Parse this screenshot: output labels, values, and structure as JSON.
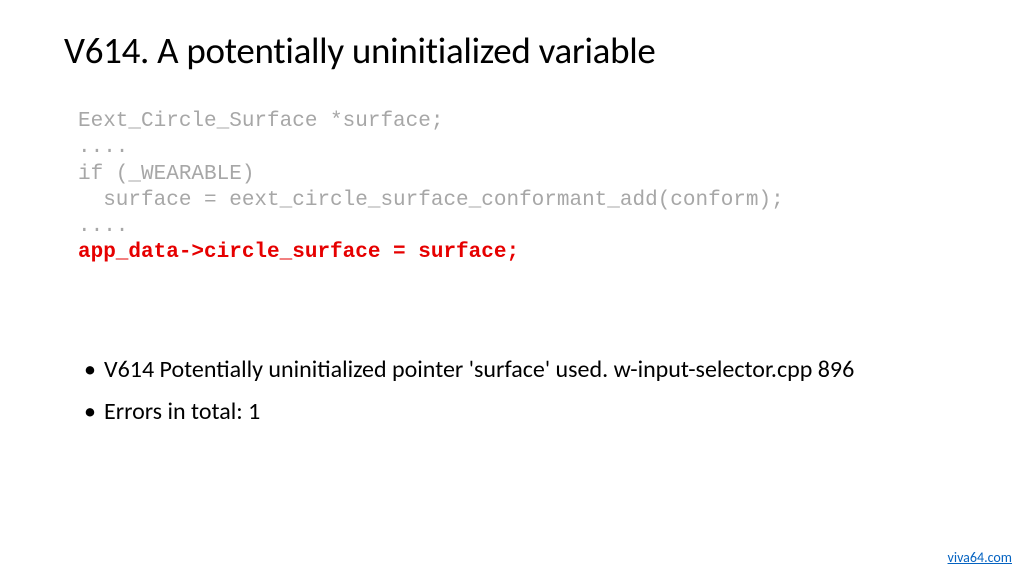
{
  "title": "V614. A potentially uninitialized variable",
  "code": {
    "l1": "Eext_Circle_Surface *surface;",
    "l2": "....",
    "l3": "if (_WEARABLE)",
    "l4": "  surface = eext_circle_surface_conformant_add(conform);",
    "l5": "....",
    "l6": "app_data->circle_surface = surface;"
  },
  "bullets": [
    "V614 Potentially uninitialized pointer 'surface' used. w-input-selector.cpp 896",
    "Errors in total: 1"
  ],
  "footer": {
    "link": "viva64.com"
  }
}
